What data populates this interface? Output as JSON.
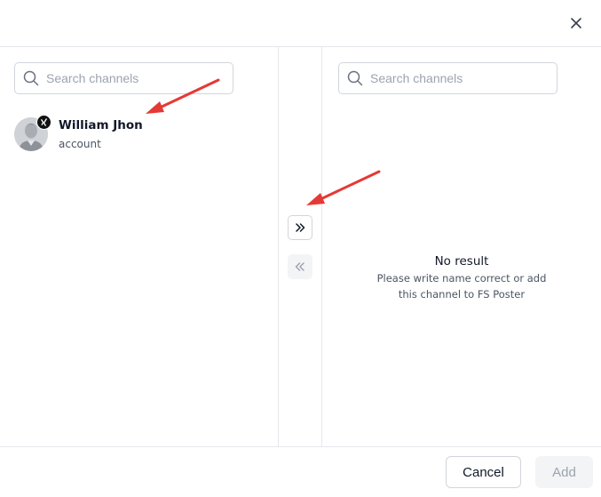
{
  "left_panel": {
    "search": {
      "placeholder": "Search channels",
      "value": ""
    },
    "channels": [
      {
        "name": "William Jhon",
        "type": "account",
        "avatar_icon": "user-avatar",
        "platform_icon": "xing-icon"
      }
    ]
  },
  "right_panel": {
    "search": {
      "placeholder": "Search channels",
      "value": ""
    },
    "empty_state": {
      "title": "No result",
      "description": "Please write name correct or add this channel to FS Poster"
    }
  },
  "middle": {
    "move_right_icon": "double-chevron-right-icon",
    "move_left_icon": "double-chevron-left-icon"
  },
  "footer": {
    "cancel_label": "Cancel",
    "add_label": "Add"
  },
  "header": {
    "close_icon": "close-icon"
  },
  "colors": {
    "border": "#e5e7eb",
    "annotation_arrow": "#e53935",
    "disabled_bg": "#f3f4f6",
    "disabled_text": "#9ca3af"
  }
}
